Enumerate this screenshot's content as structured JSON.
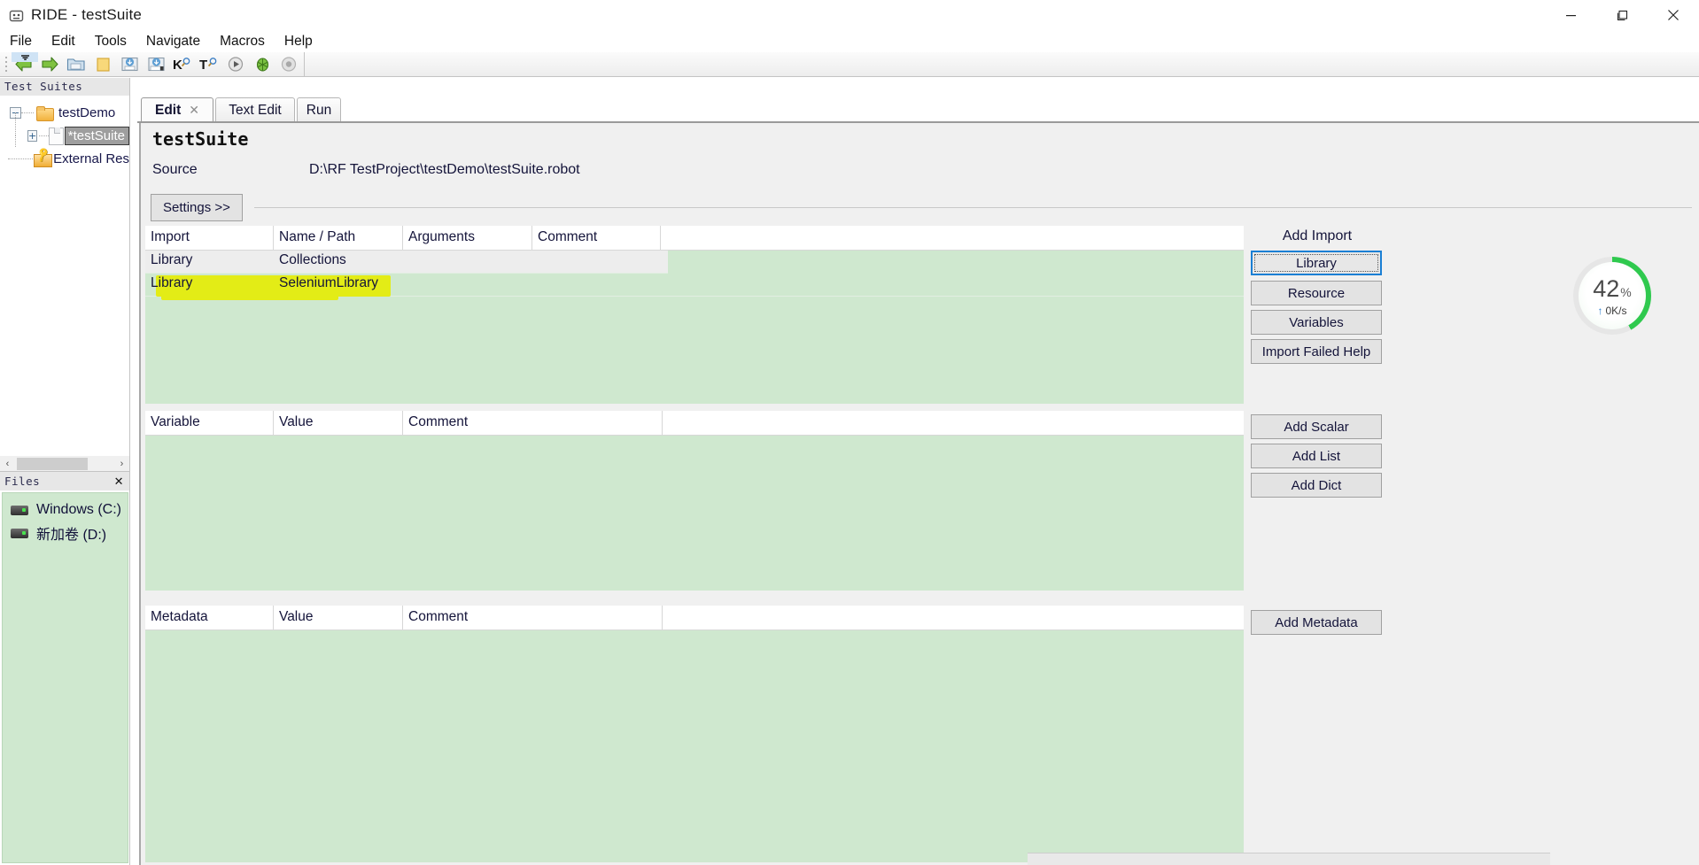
{
  "window": {
    "title": "RIDE - testSuite",
    "app_icon": "robot-icon",
    "controls": {
      "minimize": "─",
      "maximize": "❐",
      "close": "✕"
    }
  },
  "menubar": {
    "items": [
      {
        "label": "File"
      },
      {
        "label": "Edit"
      },
      {
        "label": "Tools"
      },
      {
        "label": "Navigate"
      },
      {
        "label": "Macros"
      },
      {
        "label": "Help"
      }
    ]
  },
  "toolbar": {
    "buttons": [
      {
        "name": "back-arrow-icon",
        "glyph": "⬅"
      },
      {
        "name": "forward-arrow-icon",
        "glyph": "➡"
      },
      {
        "name": "open-folder-icon",
        "glyph": "📂"
      },
      {
        "name": "new-folder-icon",
        "glyph": "📁"
      },
      {
        "name": "save-icon",
        "glyph": "⭳"
      },
      {
        "name": "save-all-icon",
        "glyph": "⭳"
      },
      {
        "name": "search-keyword-icon",
        "glyph": "K"
      },
      {
        "name": "search-tests-icon",
        "glyph": "T"
      },
      {
        "name": "run-icon",
        "glyph": "▶"
      },
      {
        "name": "debug-icon",
        "glyph": "🐞"
      },
      {
        "name": "stop-icon",
        "glyph": "◉"
      }
    ]
  },
  "suites_panel": {
    "header": "Test Suites",
    "tree": [
      {
        "label": "testDemo",
        "icon": "folder-icon",
        "expander": "−",
        "selected": false
      },
      {
        "label": "*testSuite",
        "icon": "document-icon",
        "expander": "+",
        "selected": true
      },
      {
        "label": "External Res",
        "icon": "resource-folder-icon",
        "expander": "",
        "selected": false
      }
    ],
    "scrollbar": {
      "left_arrow": "‹",
      "right_arrow": "›"
    }
  },
  "files_panel": {
    "header": "Files",
    "close_glyph": "✕",
    "drives": [
      {
        "label": "Windows (C:)",
        "icon": "drive-icon"
      },
      {
        "label": "新加卷 (D:)",
        "icon": "drive-icon"
      }
    ]
  },
  "tabs": [
    {
      "label": "Edit",
      "active": true,
      "closable": true,
      "close_glyph": "✕"
    },
    {
      "label": "Text Edit",
      "active": false,
      "closable": false
    },
    {
      "label": "Run",
      "active": false,
      "closable": false
    }
  ],
  "editor": {
    "suite_name": "testSuite",
    "source_label": "Source",
    "source_value": "D:\\RF TestProject\\testDemo\\testSuite.robot",
    "settings_button": "Settings >>"
  },
  "import_table": {
    "headers": [
      "Import",
      "Name / Path",
      "Arguments",
      "Comment"
    ],
    "rows": [
      {
        "cells": [
          "Library",
          "Collections",
          "",
          ""
        ],
        "shaded": true,
        "highlighted": false
      },
      {
        "cells": [
          "Library",
          "SeleniumLibrary",
          "",
          ""
        ],
        "shaded": false,
        "highlighted": true
      }
    ]
  },
  "variable_table": {
    "headers": [
      "Variable",
      "Value",
      "Comment"
    ],
    "rows": []
  },
  "metadata_table": {
    "headers": [
      "Metadata",
      "Value",
      "Comment"
    ],
    "rows": []
  },
  "side_panel": {
    "add_import_label": "Add Import",
    "import_buttons": [
      {
        "label": "Library",
        "focused": true
      },
      {
        "label": "Resource",
        "focused": false
      },
      {
        "label": "Variables",
        "focused": false
      },
      {
        "label": "Import Failed Help",
        "focused": false
      }
    ],
    "variable_buttons": [
      {
        "label": "Add Scalar"
      },
      {
        "label": "Add List"
      },
      {
        "label": "Add Dict"
      }
    ],
    "metadata_buttons": [
      {
        "label": "Add Metadata"
      }
    ]
  },
  "progress_widget": {
    "percent_value": "42",
    "percent_sign": "%",
    "rate": "0K/s",
    "arrow_glyph": "↑",
    "accent_color": "#2fc94e",
    "track_color": "#e6e6e6",
    "percent_number": 42
  }
}
